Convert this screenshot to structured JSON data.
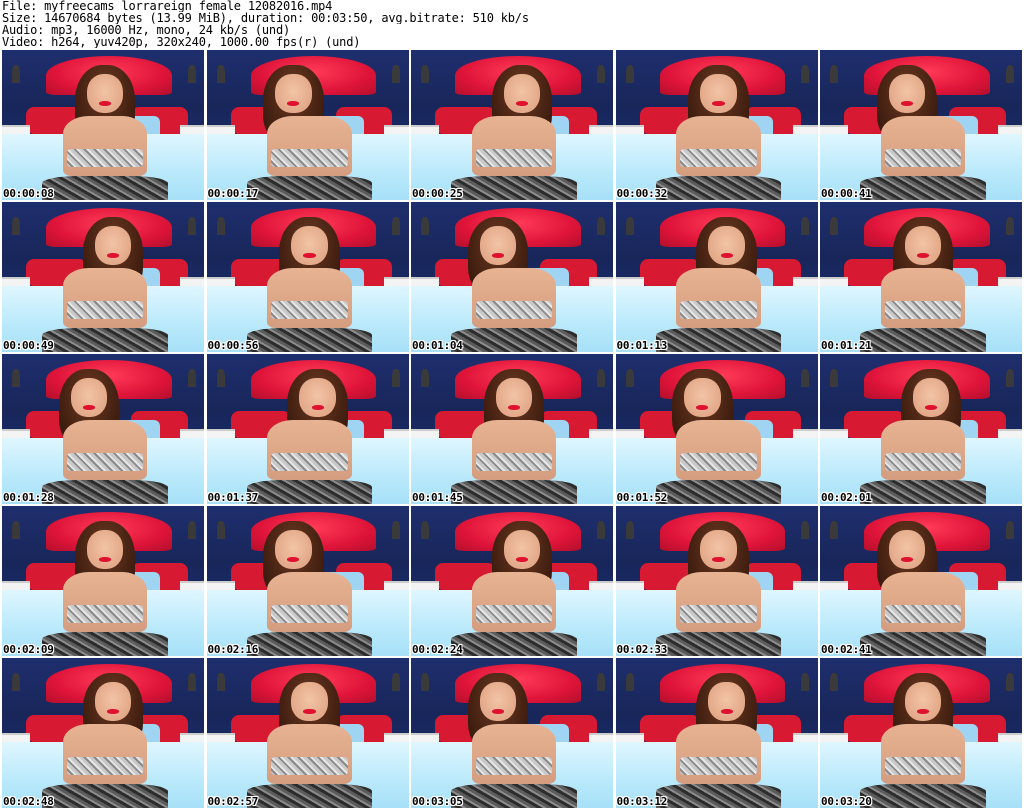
{
  "header": {
    "file_line": "File: myfreecams_lorrareign_female_12082016.mp4",
    "size_line": "Size: 14670684 bytes (13.99 MiB), duration: 00:03:50, avg.bitrate: 510 kb/s",
    "audio_line": "Audio: mp3, 16000 Hz, mono, 24 kb/s (und)",
    "video_line": "Video: h264, yuv420p, 320x240, 1000.00 fps(r) (und)"
  },
  "thumbnails": [
    {
      "timestamp": "00:00:08"
    },
    {
      "timestamp": "00:00:17"
    },
    {
      "timestamp": "00:00:25"
    },
    {
      "timestamp": "00:00:32"
    },
    {
      "timestamp": "00:00:41"
    },
    {
      "timestamp": "00:00:49"
    },
    {
      "timestamp": "00:00:56"
    },
    {
      "timestamp": "00:01:04"
    },
    {
      "timestamp": "00:01:13"
    },
    {
      "timestamp": "00:01:21"
    },
    {
      "timestamp": "00:01:28"
    },
    {
      "timestamp": "00:01:37"
    },
    {
      "timestamp": "00:01:45"
    },
    {
      "timestamp": "00:01:52"
    },
    {
      "timestamp": "00:02:01"
    },
    {
      "timestamp": "00:02:09"
    },
    {
      "timestamp": "00:02:16"
    },
    {
      "timestamp": "00:02:24"
    },
    {
      "timestamp": "00:02:33"
    },
    {
      "timestamp": "00:02:41"
    },
    {
      "timestamp": "00:02:48"
    },
    {
      "timestamp": "00:02:57"
    },
    {
      "timestamp": "00:03:05"
    },
    {
      "timestamp": "00:03:12"
    },
    {
      "timestamp": "00:03:20"
    }
  ]
}
